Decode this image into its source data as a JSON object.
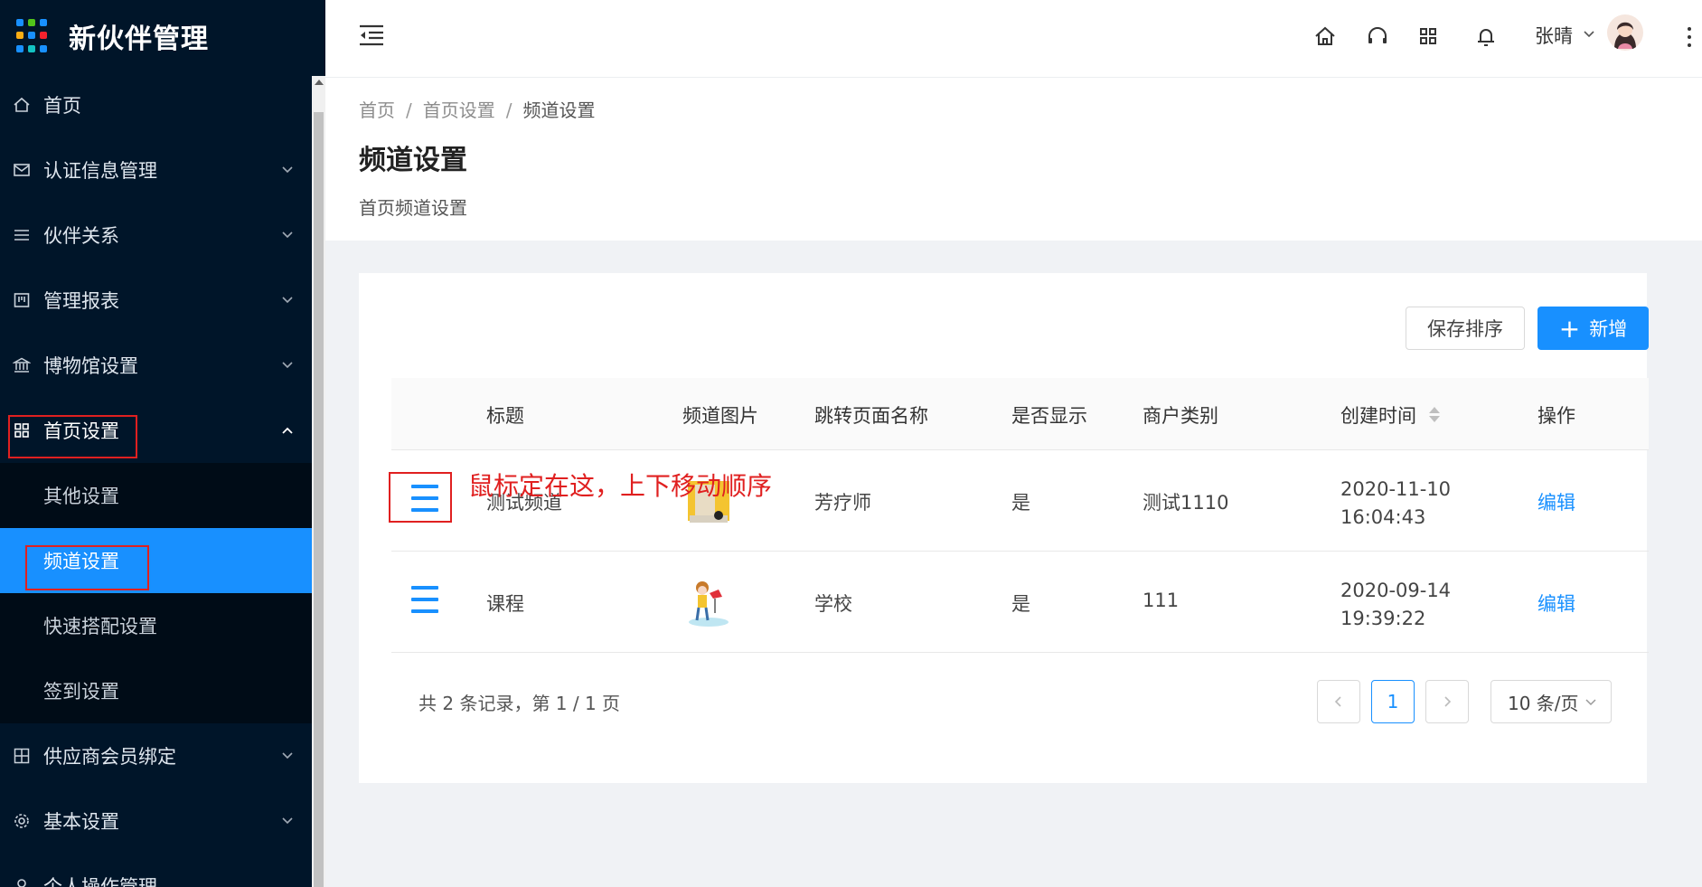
{
  "app": {
    "title": "新伙伴管理"
  },
  "sidebar": {
    "items": [
      {
        "label": "首页",
        "icon": "home-icon"
      },
      {
        "label": "认证信息管理",
        "icon": "mail-icon"
      },
      {
        "label": "伙伴关系",
        "icon": "list-icon"
      },
      {
        "label": "管理报表",
        "icon": "board-icon"
      },
      {
        "label": "博物馆设置",
        "icon": "bank-icon"
      },
      {
        "label": "首页设置",
        "icon": "appstore-icon"
      },
      {
        "label": "供应商会员绑定",
        "icon": "cluster-icon"
      },
      {
        "label": "基本设置",
        "icon": "gear-icon"
      },
      {
        "label": "个人操作管理",
        "icon": "user-icon"
      }
    ],
    "submenu": [
      {
        "label": "其他设置"
      },
      {
        "label": "频道设置"
      },
      {
        "label": "快速搭配设置"
      },
      {
        "label": "签到设置"
      }
    ]
  },
  "header": {
    "username": "张晴"
  },
  "breadcrumb": [
    "首页",
    "首页设置",
    "频道设置"
  ],
  "page": {
    "title": "频道设置",
    "description": "首页频道设置"
  },
  "toolbar": {
    "save_order": "保存排序",
    "add": "新增"
  },
  "table": {
    "columns": [
      "标题",
      "频道图片",
      "跳转页面名称",
      "是否显示",
      "商户类别",
      "创建时间",
      "操作"
    ],
    "rows": [
      {
        "title": "测试频道",
        "page": "芳疗师",
        "show": "是",
        "type": "测试1110",
        "date": "2020-11-10",
        "time": "16:04:43",
        "op": "编辑"
      },
      {
        "title": "课程",
        "page": "学校",
        "show": "是",
        "type": "111",
        "date": "2020-09-14",
        "time": "19:39:22",
        "op": "编辑"
      }
    ]
  },
  "annotation": "鼠标定在这，上下移动顺序",
  "pagination": {
    "total_text": "共 2 条记录，第 1 / 1 页",
    "current": "1",
    "page_size": "10 条/页"
  },
  "colors": {
    "sidebar_bg": "#001529",
    "primary": "#1890ff",
    "annotation": "#e02020"
  }
}
